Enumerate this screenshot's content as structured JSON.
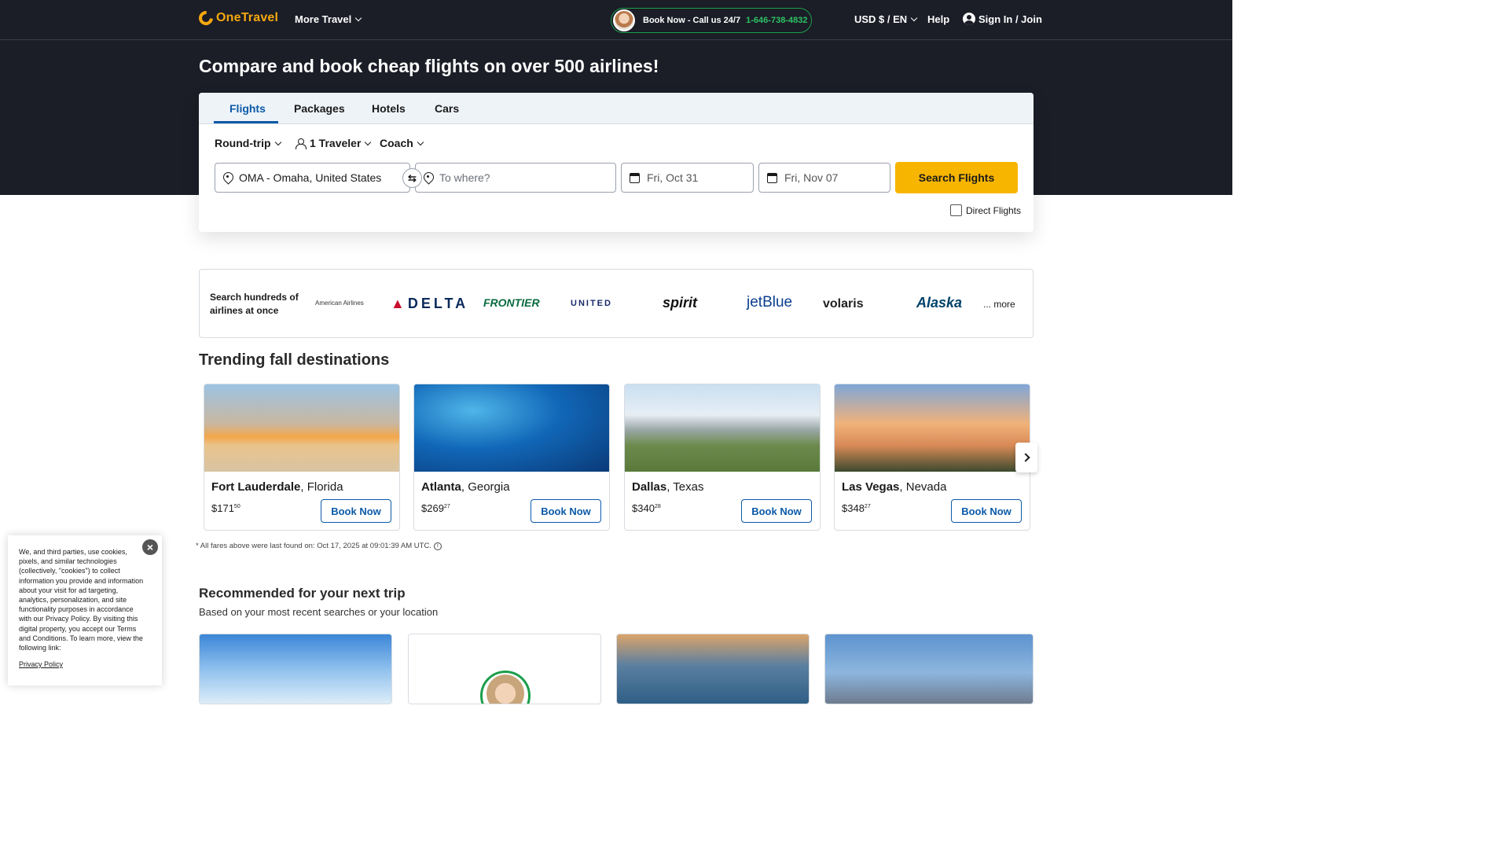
{
  "header": {
    "logo_text": "OneTravel",
    "more_travel": "More Travel",
    "book_now": "Book Now - Call us 24/7",
    "phone": "1-646-738-4832",
    "currency": "USD $ / EN",
    "help": "Help",
    "sign_in": "Sign In / Join"
  },
  "hero": {
    "title": "Compare and book cheap flights on over 500 airlines!"
  },
  "search": {
    "tabs": [
      "Flights",
      "Packages",
      "Hotels",
      "Cars"
    ],
    "active_tab": "Flights",
    "trip_type": "Round-trip",
    "travelers": "1 Traveler",
    "cabin": "Coach",
    "from": "OMA - Omaha, United States",
    "to_placeholder": "To where?",
    "depart": "Fri, Oct 31",
    "return": "Fri, Nov 07",
    "button": "Search Flights",
    "direct_flights": "Direct Flights"
  },
  "airlines": {
    "label": "Search hundreds of airlines at once",
    "logos": [
      "American Airlines",
      "DELTA",
      "FRONTIER",
      "UNITED",
      "spirit",
      "jetBlue",
      "volaris",
      "Alaska"
    ],
    "more": "... more"
  },
  "trending": {
    "title": "Trending fall destinations",
    "cards": [
      {
        "city": "Fort Lauderdale",
        "state": "Florida",
        "price": "$171",
        "cents": "50",
        "button": "Book Now"
      },
      {
        "city": "Atlanta",
        "state": "Georgia",
        "price": "$269",
        "cents": "27",
        "button": "Book Now"
      },
      {
        "city": "Dallas",
        "state": "Texas",
        "price": "$340",
        "cents": "28",
        "button": "Book Now"
      },
      {
        "city": "Las Vegas",
        "state": "Nevada",
        "price": "$348",
        "cents": "27",
        "button": "Book Now"
      }
    ],
    "fare_note": "* All fares above were last found on: Oct 17, 2025 at 09:01:39 AM UTC."
  },
  "recommended": {
    "title": "Recommended for your next trip",
    "subtitle": "Based on your most recent searches or your location"
  },
  "cookie": {
    "text": "We, and third parties, use cookies, pixels, and similar technologies (collectively, \"cookies\") to collect information you provide and information about your visit for ad targeting, analytics, personalization, and site functionality purposes in accordance with our Privacy Policy. By visiting this digital property, you accept our Terms and Conditions. To learn more, view the following link:",
    "link": "Privacy Policy"
  },
  "colors": {
    "hero_bg": "#1b1d27",
    "accent_blue": "#0b5aa8",
    "cta_yellow": "#f7b500",
    "logo_orange": "#f6a90f",
    "phone_green": "#2ec264"
  }
}
